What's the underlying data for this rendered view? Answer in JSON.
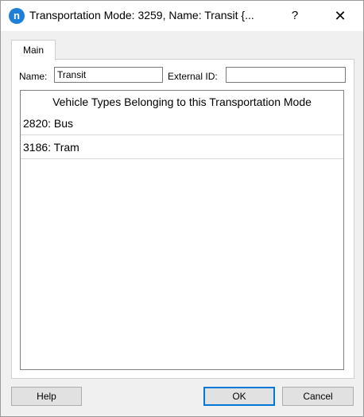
{
  "window": {
    "title": "Transportation Mode: 3259, Name: Transit  {...",
    "app_icon_letter": "n",
    "help_glyph": "?",
    "close_glyph": "✕"
  },
  "tabs": [
    {
      "label": "Main",
      "selected": true
    }
  ],
  "form": {
    "name_label": "Name:",
    "name_value": "Transit",
    "external_id_label": "External ID:",
    "external_id_value": ""
  },
  "vehicle_list": {
    "header": "Vehicle Types Belonging to this Transportation Mode",
    "items": [
      "2820: Bus",
      "3186: Tram"
    ]
  },
  "buttons": {
    "help": "Help",
    "ok": "OK",
    "cancel": "Cancel"
  },
  "colors": {
    "accent": "#0078d7",
    "app_icon": "#1e7fd8"
  }
}
